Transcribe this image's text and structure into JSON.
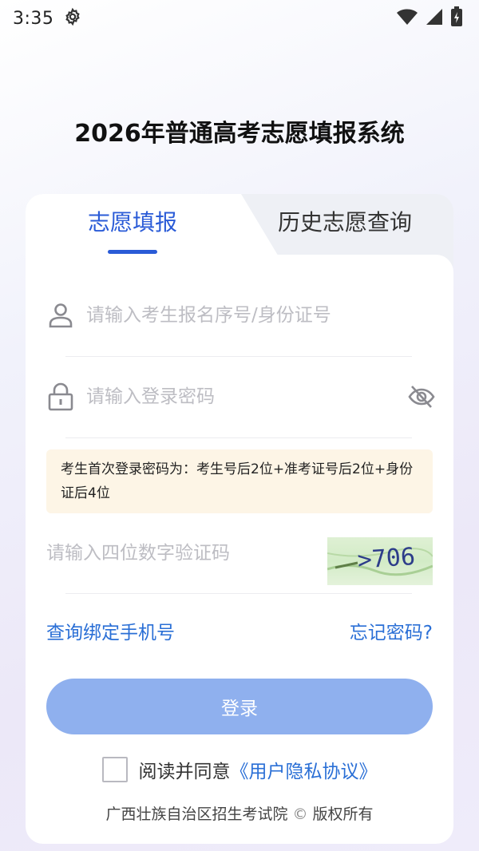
{
  "status_bar": {
    "time": "3:35",
    "icons": [
      "settings-icon",
      "wifi-icon",
      "signal-icon",
      "battery-charging-icon"
    ]
  },
  "app_title": "2026年普通高考志愿填报系统",
  "tabs": [
    {
      "label": "志愿填报",
      "active": true
    },
    {
      "label": "历史志愿查询",
      "active": false
    }
  ],
  "form": {
    "username": {
      "placeholder": "请输入考生报名序号/身份证号",
      "value": "",
      "icon": "user-icon"
    },
    "password": {
      "placeholder": "请输入登录密码",
      "value": "",
      "icon": "lock-icon",
      "toggle_icon": "eye-off-icon"
    },
    "hint": "考生首次登录密码为：考生号后2位+准考证号后2位+身份证后4位",
    "captcha": {
      "placeholder": "请输入四位数字验证码",
      "value": "",
      "image_text": ">706"
    }
  },
  "links": {
    "bind_phone": "查询绑定手机号",
    "forgot_password": "忘记密码?"
  },
  "login_button": "登录",
  "agreement": {
    "checked": false,
    "text": "阅读并同意",
    "link": "《用户隐私协议》"
  },
  "footer": {
    "org": "广西壮族自治区招生考试院",
    "copyright_symbol": "©",
    "rights": "版权所有"
  },
  "colors": {
    "primary": "#2a5bd7",
    "link": "#2a6fd6",
    "button_disabled": "#8fb0ee",
    "hint_bg": "#fdf5e6"
  }
}
